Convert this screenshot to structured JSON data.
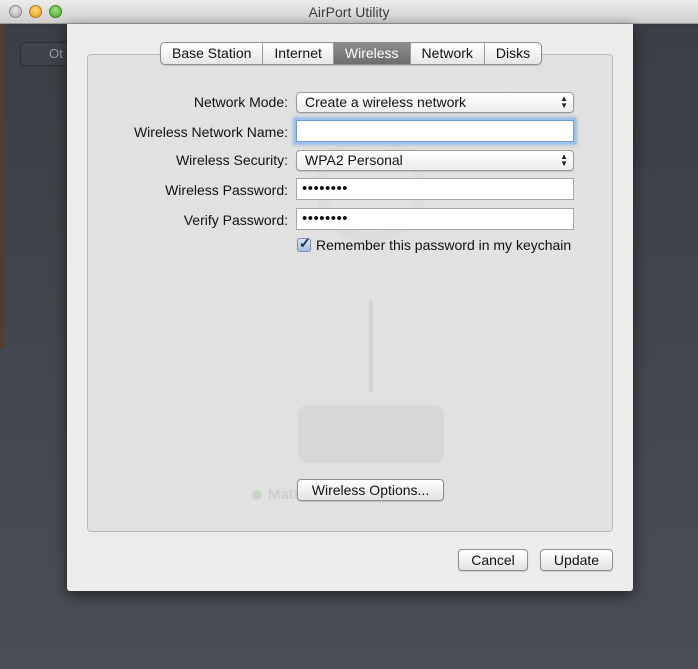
{
  "window": {
    "title": "AirPort Utility",
    "background_button_label": "Ot"
  },
  "tabs": [
    {
      "label": "Base Station",
      "selected": false
    },
    {
      "label": "Internet",
      "selected": false
    },
    {
      "label": "Wireless",
      "selected": true
    },
    {
      "label": "Network",
      "selected": false
    },
    {
      "label": "Disks",
      "selected": false
    }
  ],
  "form": {
    "network_mode_label": "Network Mode:",
    "network_mode_value": "Create a wireless network",
    "network_name_label": "Wireless Network Name:",
    "network_name_value": "",
    "security_label": "Wireless Security:",
    "security_value": "WPA2 Personal",
    "password_label": "Wireless Password:",
    "password_value": "••••••••",
    "verify_label": "Verify Password:",
    "verify_value": "••••••••",
    "keychain_label": "Remember this password in my keychain",
    "keychain_checked": true
  },
  "device": {
    "name": "Matt's AirPort Extreme"
  },
  "buttons": {
    "wireless_options": "Wireless Options...",
    "cancel": "Cancel",
    "update": "Update"
  },
  "icons": {
    "popup": "up-down-chevron-icon",
    "check": "checkmark-icon"
  },
  "colors": {
    "selected_tab": "#7d7d7d",
    "focus_ring": "#9ec0ea",
    "status_dot": "#c9d8c6"
  }
}
